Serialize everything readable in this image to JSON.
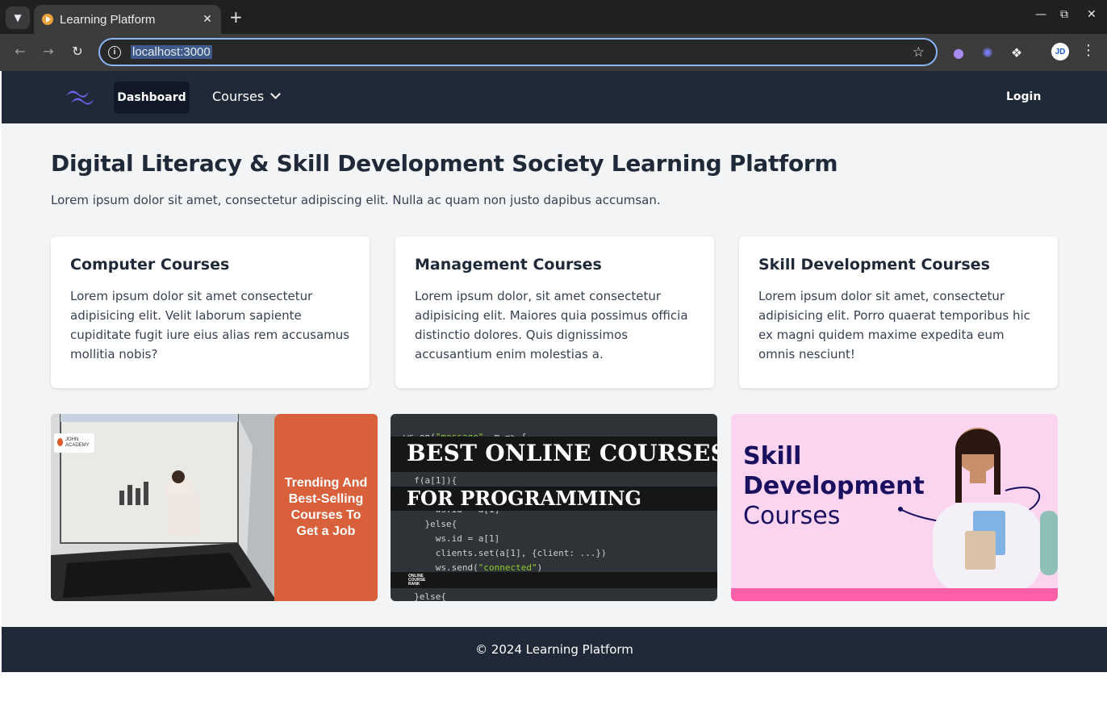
{
  "browser": {
    "tab_title": "Learning Platform",
    "url": "localhost:3000",
    "avatar_initials": "JD"
  },
  "nav": {
    "dashboard_label": "Dashboard",
    "courses_label": "Courses",
    "login_label": "Login"
  },
  "hero": {
    "title": "Digital Literacy & Skill Development Society Learning Platform",
    "subtitle": "Lorem ipsum dolor sit amet, consectetur adipiscing elit. Nulla ac quam non justo dapibus accumsan."
  },
  "cards": [
    {
      "title": "Computer Courses",
      "description": "Lorem ipsum dolor sit amet consectetur adipisicing elit. Velit laborum sapiente cupiditate fugit iure eius alias rem accusamus mollitia nobis?"
    },
    {
      "title": "Management Courses",
      "description": "Lorem ipsum dolor, sit amet consectetur adipisicing elit. Maiores quia possimus officia distinctio dolores. Quis dignissimos accusantium enim molestias a."
    },
    {
      "title": "Skill Development Courses",
      "description": "Lorem ipsum dolor sit amet, consectetur adipisicing elit. Porro quaerat temporibus hic ex magni quidem maxime expedita eum omnis nesciunt!"
    }
  ],
  "banners": {
    "banner1": {
      "brand_line1": "JOHN",
      "brand_line2": "ACADEMY",
      "text": "Trending And Best-Selling Courses To Get a Job"
    },
    "banner2": {
      "line1": "BEST ONLINE COURSES",
      "line2": "FOR PROGRAMMING",
      "brand": "ONLINE COURSE RANK"
    },
    "banner3": {
      "line1": "Skill",
      "line2": "Development",
      "line3": "Courses"
    }
  },
  "footer": {
    "text": "© 2024 Learning Platform"
  },
  "colors": {
    "nav_bg": "#1f2937",
    "content_bg": "#f3f4f6",
    "banner1_orange": "#d8613c",
    "banner3_pink": "#fbd5ef",
    "banner3_stripe": "#ff5fa8"
  }
}
